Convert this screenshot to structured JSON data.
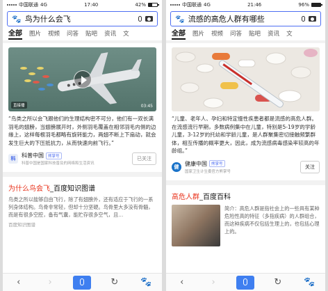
{
  "colors": {
    "accent": "#4e6ef2",
    "highlight": "#e8311a",
    "voice": "#3f7ff0"
  },
  "left": {
    "status": {
      "carrier": "中国联通",
      "network": "4G",
      "time": "17:40",
      "battery": "42%",
      "battery_level": 0.42
    },
    "search": {
      "query": "鸟为什么会飞"
    },
    "tabs": [
      "全部",
      "图片",
      "视频",
      "问答",
      "贴吧",
      "资讯",
      "文"
    ],
    "video_card": {
      "live_badge": "直接播",
      "duration": "03:45",
      "text": "“鸟类之所以会飞跟他们的生理结构密不可分，他们有一双长满羽毛的翅膀，当翅膀展开时，外侧羽毛覆盖在相邻羽毛内侧的边缘上，这样每根羽毛都略有旋转能力，两翅不断上下扇动，就会发生巨大的下压抵抗力，从而快速向前飞行。”",
      "source_name": "科普中国",
      "source_tag": "熊掌号",
      "source_desc": "科普中国是国家科技普及的网络和生活资讯",
      "follow": "已关注"
    },
    "result": {
      "title_highlight": "为什么鸟会飞",
      "title_rest": "_百度知识图谱",
      "body": "鸟类之所以能够自由飞行，除了有翅膀外，还有适应于飞行的一系列身体结构。鸟骨非常轻，但却十分坚硬。鸟骨里大多没有骨髓，而是有很多空腔，备有气囊，能贮存很多空气，且…",
      "source": "百度知识图谱"
    },
    "nav": {
      "back": "‹",
      "forward": "›",
      "refresh": "↻",
      "home": "🐾"
    }
  },
  "right": {
    "status": {
      "carrier": "中国联通",
      "network": "4G",
      "time": "21:46",
      "battery": "96%",
      "battery_level": 0.96
    },
    "search": {
      "query": "流感的高危人群有哪些"
    },
    "tabs": [
      "全部",
      "图片",
      "视频",
      "问答",
      "贴吧",
      "资讯",
      "文"
    ],
    "image_card": {
      "text": "“儿童、老年人、孕妇和特定慢性疾患者都是流感的高危人群。在流感流行早期，多数病例集中在儿童，特别是5-19岁的学龄儿童，3-12岁的托幼和学龄儿童，是人群聚集密切接触频繁群体，相互传播的概率更大，因此，成为流感病毒感染率较高的年龄组。”",
      "source_name": "健康中国",
      "source_tag": "熊掌号",
      "source_desc": "国家卫生计生委官方熊掌号",
      "follow": "关注"
    },
    "result": {
      "title_highlight": "高危人群",
      "title_rest": "_百度百科",
      "body": "简介：高危人群是指社会上的一些具有某种危险性高的特征（多指疾病）的人群组合，而这种疾病不仅包括生理上的，也包括心理上的。"
    },
    "nav": {
      "back": "‹",
      "forward": "›",
      "refresh": "↻",
      "home": "🐾"
    }
  }
}
